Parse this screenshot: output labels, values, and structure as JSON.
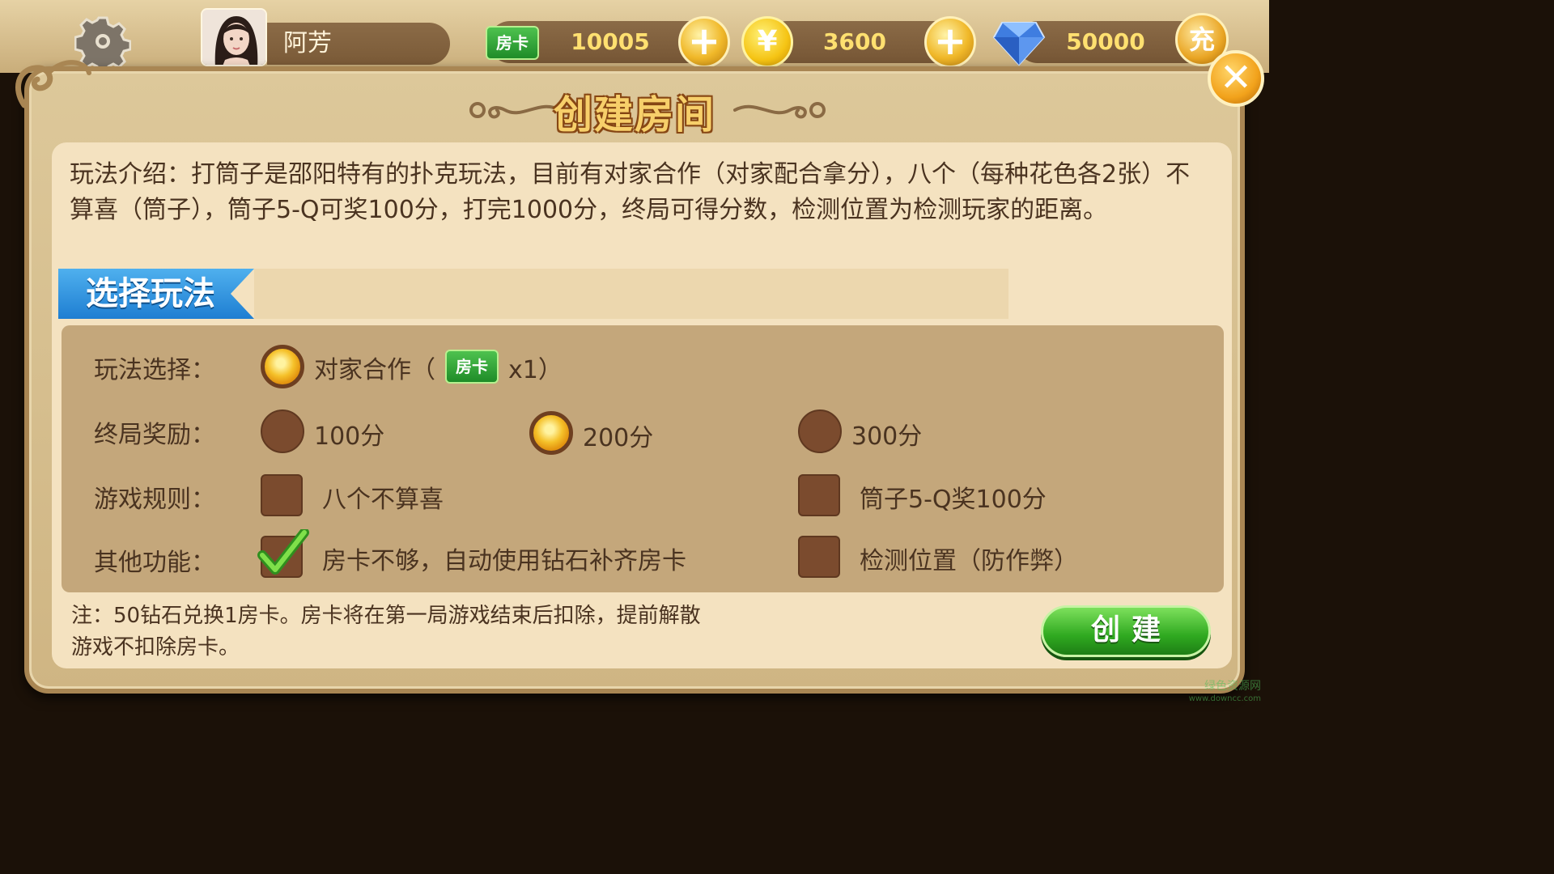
{
  "topbar": {
    "player_name": "阿芳",
    "room_card_label": "房卡",
    "room_cards": "10005",
    "gold_symbol": "¥",
    "gold": "3600",
    "diamonds": "50000",
    "plus_symbol": "+",
    "charge_label": "充"
  },
  "dialog": {
    "title": "创建房间",
    "close_symbol": "✕",
    "intro": "玩法介绍：打筒子是邵阳特有的扑克玩法，目前有对家合作（对家配合拿分），八个（每种花色各2张）不算喜（筒子），筒子5-Q可奖100分，打完1000分，终局可得分数，检测位置为检测玩家的距离。",
    "section_title": "选择玩法",
    "rows": {
      "mode": {
        "label": "玩法选择：",
        "option": "对家合作（",
        "card_label": "房卡",
        "cost": "x1）",
        "selected": true
      },
      "reward": {
        "label": "终局奖励：",
        "options": [
          "100分",
          "200分",
          "300分"
        ],
        "selected_index": 1
      },
      "rules": {
        "label": "游戏规则：",
        "options": [
          "八个不算喜",
          "筒子5-Q奖100分"
        ],
        "checked": [
          false,
          false
        ]
      },
      "other": {
        "label": "其他功能：",
        "options": [
          "房卡不够，自动使用钻石补齐房卡",
          "检测位置（防作弊）"
        ],
        "checked": [
          true,
          false
        ]
      }
    },
    "note": "注：50钻石兑换1房卡。房卡将在第一局游戏结束后扣除，提前解散游戏不扣除房卡。",
    "create_label": "创建"
  },
  "watermark": {
    "line1": "绿色资源网",
    "line2": "www.downcc.com"
  },
  "colors": {
    "panel": "#f4e2c0",
    "accent_blue": "#1e7ed2",
    "button_green": "#2fa920",
    "radio_on": "#f5c12a"
  },
  "icons": [
    "gear-icon",
    "avatar",
    "room-card-icon",
    "plus-icon",
    "coin-icon",
    "diamond-icon",
    "close-icon",
    "check-icon"
  ]
}
